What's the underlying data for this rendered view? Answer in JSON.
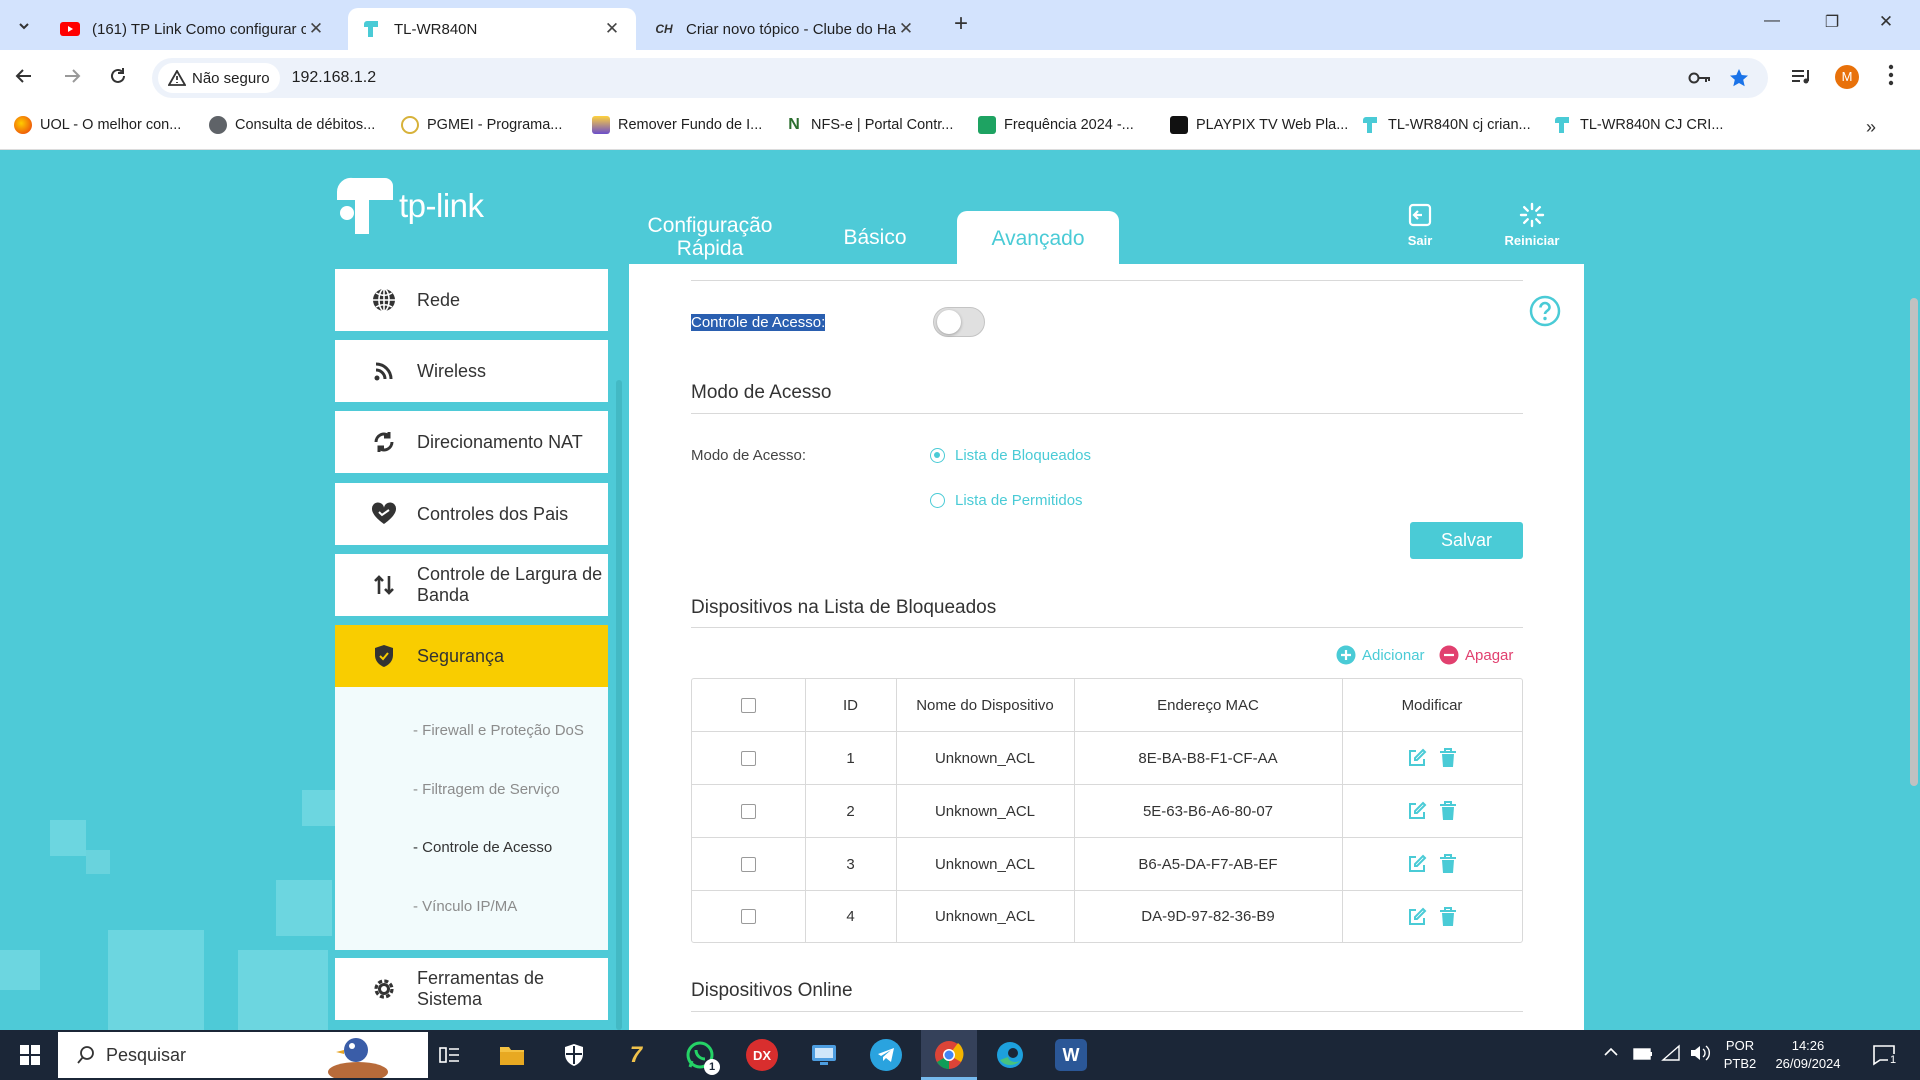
{
  "browser": {
    "tabs": [
      {
        "label": "(161) TP Link Como configurar c",
        "icon": "youtube-icon"
      },
      {
        "label": "TL-WR840N",
        "icon": "tplink-icon"
      },
      {
        "label": "Criar novo tópico - Clube do Ha",
        "icon": "forum-icon"
      }
    ],
    "new_tab": "+",
    "window_controls": {
      "minimize": "—",
      "maximize": "❐",
      "close": "✕"
    },
    "security_label": "Não seguro",
    "url": "192.168.1.2",
    "profile_initial": "M",
    "bookmarks": [
      "UOL - O melhor con...",
      "Consulta de débitos...",
      "PGMEI - Programa...",
      "Remover Fundo de I...",
      "NFS-e | Portal Contr...",
      "Frequência 2024 -...",
      "PLAYPIX TV Web Pla...",
      "TL-WR840N cj crian...",
      "TL-WR840N CJ CRI..."
    ]
  },
  "router": {
    "logo": "tp-link",
    "nav": {
      "quick_setup": "Configuração Rápida",
      "basic": "Básico",
      "advanced": "Avançado",
      "logout": "Sair",
      "reboot": "Reiniciar"
    },
    "sidebar": [
      {
        "label": "Rede",
        "icon": "globe-icon"
      },
      {
        "label": "Wireless",
        "icon": "wifi-icon"
      },
      {
        "label": "Direcionamento NAT",
        "icon": "nat-icon"
      },
      {
        "label": "Controles dos Pais",
        "icon": "heart-icon"
      },
      {
        "label": "Controle de Largura de Banda",
        "icon": "bandwidth-icon"
      },
      {
        "label": "Segurança",
        "icon": "shield-icon"
      },
      {
        "label": "Ferramentas de Sistema",
        "icon": "gear-icon"
      }
    ],
    "security_submenu": [
      "- Firewall e Proteção DoS",
      "- Filtragem de Serviço",
      "- Controle de Acesso",
      "- Vínculo IP/MA"
    ],
    "main": {
      "top_title": "Controle de Acesso",
      "access_control_label": "Controle de Acesso:",
      "access_control_enabled": false,
      "mode_title": "Modo de Acesso",
      "mode_label": "Modo de Acesso:",
      "mode_options": [
        "Lista de Bloqueados",
        "Lista de Permitidos"
      ],
      "mode_selected": "Lista de Bloqueados",
      "save_button": "Salvar",
      "blocked_title": "Dispositivos na Lista de Bloqueados",
      "add_label": "Adicionar",
      "delete_label": "Apagar",
      "table": {
        "headers": [
          "ID",
          "Nome do Dispositivo",
          "Endereço MAC",
          "Modificar"
        ],
        "rows": [
          {
            "id": "1",
            "name": "Unknown_ACL",
            "mac": "8E-BA-B8-F1-CF-AA"
          },
          {
            "id": "2",
            "name": "Unknown_ACL",
            "mac": "5E-63-B6-A6-80-07"
          },
          {
            "id": "3",
            "name": "Unknown_ACL",
            "mac": "B6-A5-DA-F7-AB-EF"
          },
          {
            "id": "4",
            "name": "Unknown_ACL",
            "mac": "DA-9D-97-82-36-B9"
          }
        ]
      },
      "online_title": "Dispositivos Online"
    }
  },
  "taskbar": {
    "search_placeholder": "Pesquisar",
    "whatsapp_badge": "1",
    "lang_top": "POR",
    "lang_bottom": "PTB2",
    "time": "14:26",
    "date": "26/09/2024",
    "notification_count": "1"
  },
  "colors": {
    "accent": "#4acbd6",
    "page_bg": "#4ecad7",
    "active_menu": "#f9cd00",
    "danger": "#e1406f"
  }
}
